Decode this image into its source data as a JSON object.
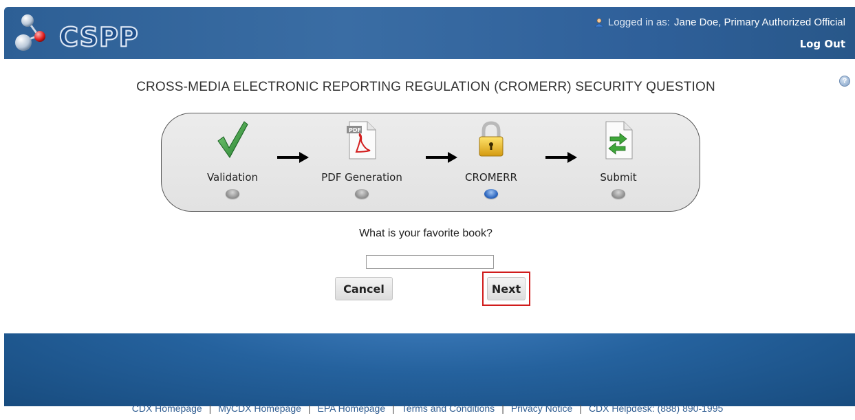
{
  "header": {
    "logo_text": "CSPP",
    "logged_in_label": "Logged in as:",
    "user_name": "Jane Doe, Primary Authorized Official",
    "logout_label": "Log Out"
  },
  "page": {
    "title": "CROSS-MEDIA ELECTRONIC REPORTING REGULATION (CROMERR) SECURITY QUESTION",
    "help_icon": "help-icon"
  },
  "steps": [
    {
      "label": "Validation",
      "icon": "checkmark-icon",
      "active": false
    },
    {
      "label": "PDF Generation",
      "icon": "pdf-document-icon",
      "active": false
    },
    {
      "label": "CROMERR",
      "icon": "padlock-icon",
      "active": true
    },
    {
      "label": "Submit",
      "icon": "submit-document-icon",
      "active": false
    }
  ],
  "form": {
    "question": "What is your favorite book?",
    "answer_value": "",
    "cancel_label": "Cancel",
    "next_label": "Next"
  },
  "footer": {
    "links": [
      "CDX Homepage",
      "MyCDX Homepage",
      "EPA Homepage",
      "Terms and Conditions",
      "Privacy Notice",
      "CDX Helpdesk: (888) 890-1995"
    ]
  },
  "colors": {
    "header_blue": "#3a6da4",
    "footer_blue": "#25629e",
    "highlight_red": "#d01c1c",
    "active_dot_blue": "#2a64bd"
  }
}
